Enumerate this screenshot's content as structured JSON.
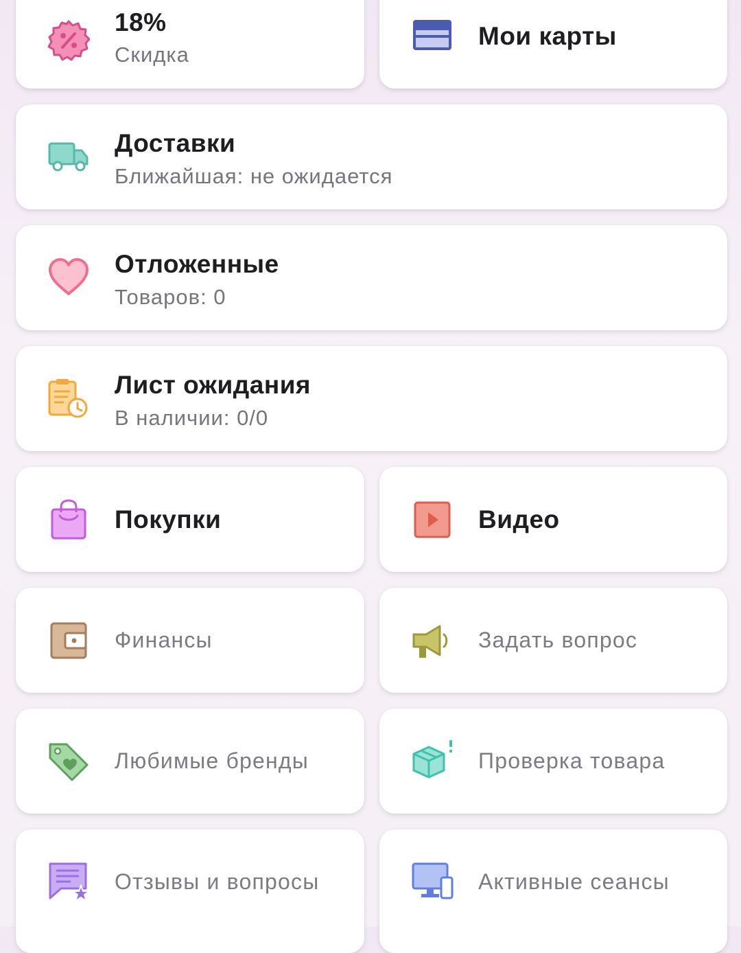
{
  "discount": {
    "value": "18%",
    "label": "Скидка"
  },
  "cards": {
    "title": "Мои карты"
  },
  "deliveries": {
    "title": "Доставки",
    "subtitle": "Ближайшая: не ожидается"
  },
  "favorites": {
    "title": "Отложенные",
    "subtitle": "Товаров: 0"
  },
  "waitlist": {
    "title": "Лист ожидания",
    "subtitle": "В наличии: 0/0"
  },
  "purchases": {
    "title": "Покупки"
  },
  "video": {
    "title": "Видео"
  },
  "finance": {
    "title": "Финансы"
  },
  "ask": {
    "title": "Задать вопрос"
  },
  "brands": {
    "title": "Любимые бренды"
  },
  "check": {
    "title": "Проверка товара"
  },
  "reviews": {
    "title": "Отзывы и вопросы"
  },
  "sessions": {
    "title": "Активные сеансы"
  },
  "colors": {
    "discount": "#d44f8a",
    "cards": "#4a5bb0",
    "delivery": "#57b7a9",
    "heart": "#ef6f8e",
    "waitlist": "#f2a83a",
    "purchases": "#c45bd8",
    "video": "#e25b4d",
    "finance": "#a67c5b",
    "ask": "#9a9a3a",
    "brands": "#5e9f5e",
    "check": "#3fc1ad",
    "reviews": "#9b6fe0",
    "sessions": "#5f7ee0"
  }
}
